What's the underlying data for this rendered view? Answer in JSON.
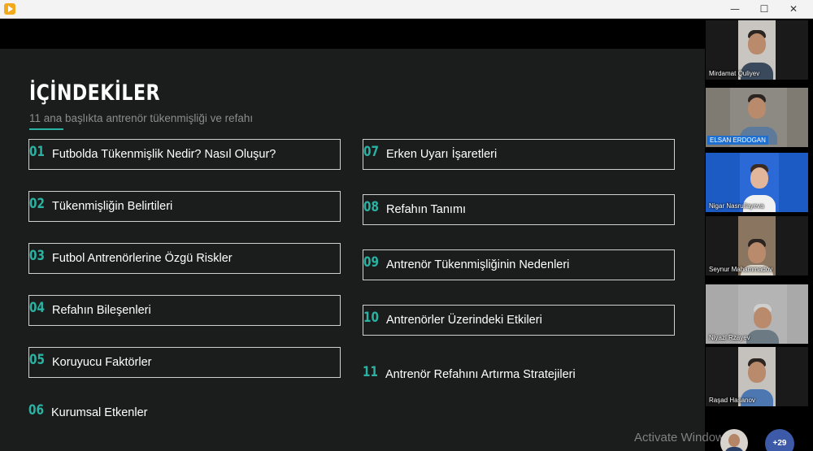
{
  "slide": {
    "title": "İÇİNDEKİLER",
    "subtitle": "11 ana başlıkta antrenör tükenmişliği ve refahı",
    "left_items": [
      {
        "num": "01",
        "label": "Futbolda Tükenmişlik Nedir? Nasıl Oluşur?"
      },
      {
        "num": "02",
        "label": "Tükenmişliğin Belirtileri"
      },
      {
        "num": "03",
        "label": "Futbol Antrenörlerine Özgü Riskler"
      },
      {
        "num": "04",
        "label": "Refahın Bileşenleri"
      },
      {
        "num": "05",
        "label": "Koruyucu Faktörler"
      },
      {
        "num": "06",
        "label": "Kurumsal Etkenler"
      }
    ],
    "right_items": [
      {
        "num": "07",
        "label": "Erken Uyarı İşaretleri"
      },
      {
        "num": "08",
        "label": "Refahın Tanımı"
      },
      {
        "num": "09",
        "label": "Antrenör Tükenmişliğinin Nedenleri"
      },
      {
        "num": "10",
        "label": "Antrenörler Üzerindeki Etkileri"
      },
      {
        "num": "11",
        "label": "Antrenör Refahını Artırma Stratejileri"
      }
    ]
  },
  "participants": [
    {
      "name": "Mirdamat Quliyev",
      "muted_icon": "mic-off-icon"
    },
    {
      "name": "ELSAN ERDOGAN",
      "muted_icon": ""
    },
    {
      "name": "Nigar Nasrullayeva",
      "muted_icon": "mic-off-icon"
    },
    {
      "name": "Seynur Mahammadov",
      "muted_icon": "mic-off-icon"
    },
    {
      "name": "Niyazi Rzayev",
      "muted_icon": "mic-off-icon"
    },
    {
      "name": "Raşad Hasanov",
      "muted_icon": "mic-off-icon"
    }
  ],
  "more_count": "+29",
  "watermark": "Activate Windows",
  "window": {
    "minimize": "—",
    "maximize": "☐",
    "close": "✕"
  },
  "colors": {
    "accent": "#2ab3a3",
    "slide_bg": "#1b1d1c",
    "highlight_name": "#1f6fd1"
  }
}
